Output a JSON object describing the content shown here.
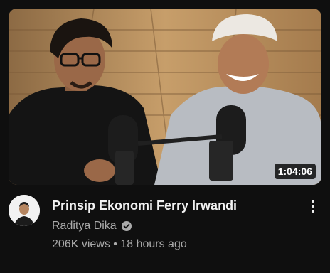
{
  "video": {
    "title": "Prinsip Ekonomi Ferry Irwandi",
    "duration": "1:04:06",
    "channel": "Raditya Dika",
    "views": "206K views",
    "separator": "•",
    "age": "18 hours ago",
    "verified": true
  },
  "icons": {
    "verified": "verified-check-icon",
    "more": "more-vert-icon"
  },
  "colors": {
    "background": "#0f0f0f",
    "title": "#f1f1f1",
    "secondary_text": "#aaaaaa"
  }
}
